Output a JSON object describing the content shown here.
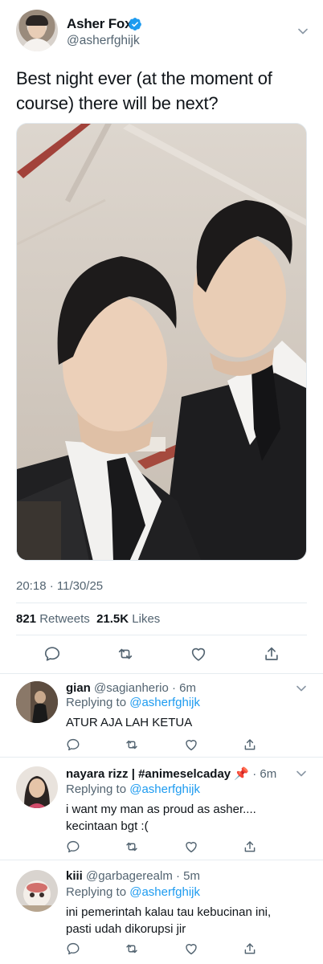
{
  "tweet": {
    "display_name": "Asher Fox",
    "handle": "@asherfghijk",
    "text": "Best night ever (at the moment of course) there will be next?",
    "timestamp": "20:18 · 11/30/25",
    "retweets_count": "821",
    "retweets_label": "Retweets",
    "likes_count": "21.5K",
    "likes_label": "Likes"
  },
  "replies": [
    {
      "name": "gian",
      "meta": "@sagianherio · 6m",
      "replying_prefix": "Replying to",
      "replying_handle": "@asherfghijk",
      "text": "ATUR AJA LAH KETUA"
    },
    {
      "name": "nayara rizz | #animeselcaday",
      "name_emoji": "📌",
      "meta": "· 6m",
      "replying_prefix": "Replying to",
      "replying_handle": "@asherfghijk",
      "text": "i want my man as proud as asher.... kecintaan bgt :("
    },
    {
      "name": "kiii",
      "meta": "@garbagerealm · 5m",
      "replying_prefix": "Replying to",
      "replying_handle": "@asherfghijk",
      "text": "ini pemerintah kalau tau kebucinan ini, pasti udah dikorupsi jir"
    }
  ],
  "icons": {
    "verified": "verified-badge-icon",
    "reply": "reply-icon",
    "retweet": "retweet-icon",
    "like": "heart-icon",
    "share": "share-icon",
    "more": "chevron-down-icon"
  },
  "colors": {
    "accent": "#1d9bf0",
    "secondary_text": "#536471",
    "divider": "#e6ecf0"
  }
}
